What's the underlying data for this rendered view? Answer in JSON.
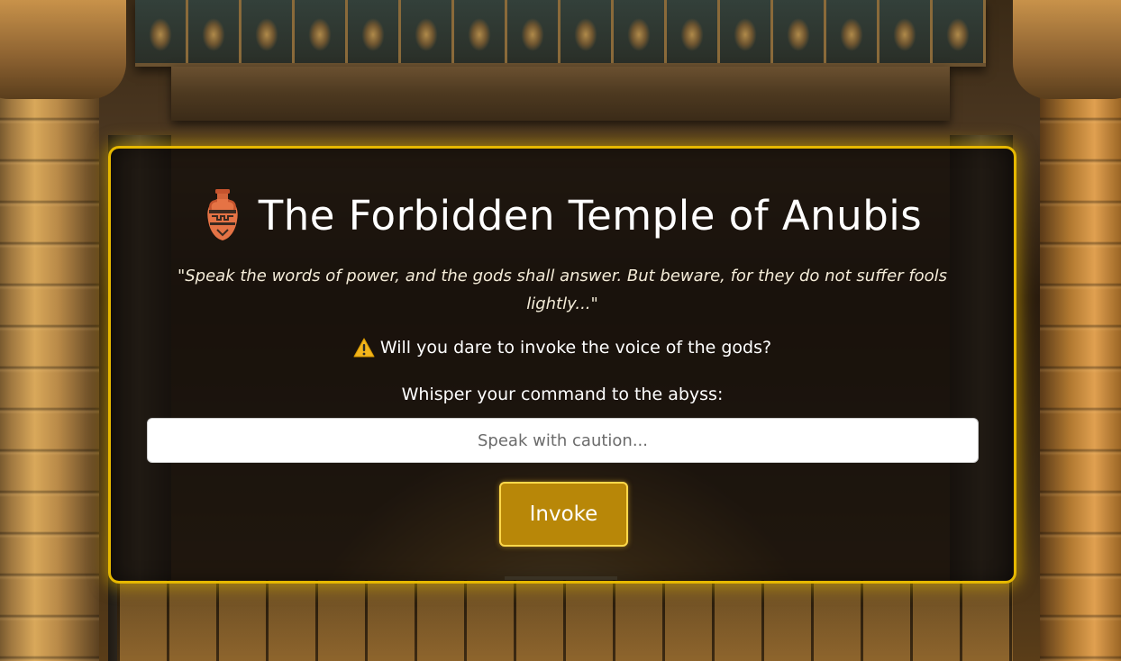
{
  "card": {
    "title": "The Forbidden Temple of Anubis",
    "title_icon": "amphora-icon",
    "quote": "\"Speak the words of power, and the gods shall answer. But beware, for they do not suffer fools lightly...\"",
    "warning_icon": "warning-icon",
    "warning_text": "Will you dare to invoke the voice of the gods?",
    "prompt_label": "Whisper your command to the abyss:",
    "input": {
      "value": "",
      "placeholder": "Speak with caution..."
    },
    "invoke_label": "Invoke"
  },
  "colors": {
    "accent_gold": "#e6b800",
    "button_bg": "#b88708",
    "card_bg": "rgba(20, 16, 12, 0.78)"
  }
}
